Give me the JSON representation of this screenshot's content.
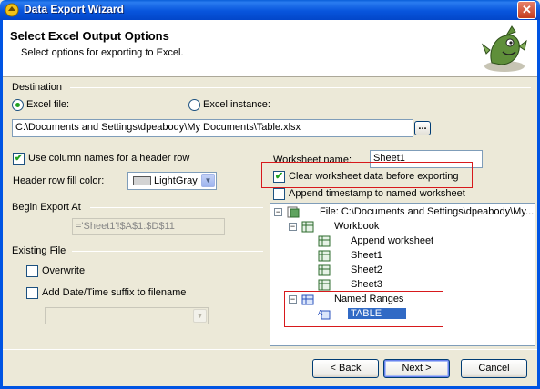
{
  "window": {
    "title": "Data Export Wizard",
    "close_glyph": "✕"
  },
  "header": {
    "title": "Select Excel Output Options",
    "subtitle": "Select options for exporting to Excel."
  },
  "destination": {
    "section_label": "Destination",
    "excel_file_label": "Excel file:",
    "excel_file_selected": true,
    "excel_instance_label": "Excel instance:",
    "file_path": "C:\\Documents and Settings\\dpeabody\\My Documents\\Table.xlsx",
    "browse_label": "..."
  },
  "options": {
    "use_column_names_label": "Use column names for a header row",
    "use_column_names_checked": true,
    "header_fill_label": "Header row fill color:",
    "header_fill_value": "LightGray",
    "worksheet_name_label": "Worksheet name:",
    "worksheet_name_value": "Sheet1",
    "clear_worksheet_label": "Clear worksheet data before exporting",
    "clear_worksheet_checked": true,
    "append_timestamp_label": "Append timestamp to named worksheet",
    "append_timestamp_checked": false
  },
  "begin_export": {
    "section_label": "Begin Export At",
    "value": "='Sheet1'!$A$1:$D$11"
  },
  "existing_file": {
    "section_label": "Existing File",
    "overwrite_label": "Overwrite",
    "overwrite_checked": false,
    "add_suffix_label": "Add Date/Time suffix to filename",
    "add_suffix_checked": false,
    "suffix_value": ""
  },
  "tree": {
    "file_label": "File: C:\\Documents and Settings\\dpeabody\\My...",
    "workbook_label": "Workbook",
    "sheets": [
      "Append worksheet",
      "Sheet1",
      "Sheet2",
      "Sheet3"
    ],
    "named_ranges_label": "Named Ranges",
    "named_range_item": "TABLE",
    "expand_glyph": "−"
  },
  "buttons": {
    "back": "< Back",
    "next": "Next >",
    "cancel": "Cancel"
  },
  "colors": {
    "accent": "#0054e3",
    "highlight_box": "#d7191c",
    "selection": "#316ac5"
  },
  "glyphs": {
    "check": "✔",
    "arrow": "▼"
  }
}
